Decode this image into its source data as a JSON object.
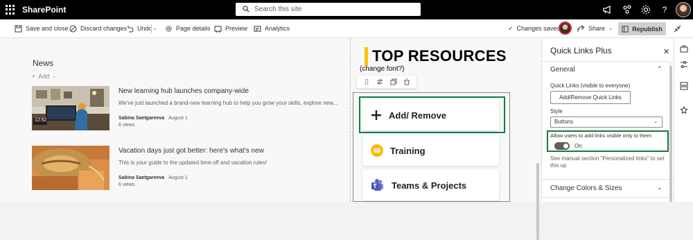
{
  "app": {
    "name": "SharePoint"
  },
  "search": {
    "placeholder": "Search this site"
  },
  "topbar": {
    "icons": [
      "megaphone-icon",
      "share-network-icon",
      "settings-gear-icon",
      "help-icon",
      "profile-avatar"
    ]
  },
  "commandbar": {
    "save_and_close": "Save and close",
    "discard_changes": "Discard changes",
    "undo": "Undo",
    "page_details": "Page details",
    "preview": "Preview",
    "analytics": "Analytics",
    "status": "Changes saved",
    "share": "Share",
    "republish": "Republish"
  },
  "news": {
    "title": "News",
    "add_label": "Add",
    "items": [
      {
        "headline": "New learning hub launches company-wide",
        "description": "We've just launched a brand-new learning hub to help you grow your skills, explore new...",
        "author": "Sabina Saetgareeva",
        "date": "August 1",
        "views": "6 views",
        "image_caption": "12:52"
      },
      {
        "headline": "Vacation days just got better: here's what's new",
        "description": "This is your guide to the updated time-off and vacation rules!",
        "author": "Sabina Saetgareeva",
        "date": "August 1",
        "views": "6 views"
      }
    ]
  },
  "resources": {
    "title": "TOP RESOURCES",
    "subtitle": "(change font?)",
    "toolbar_icons": [
      "drag-handle-icon",
      "edit-properties-icon",
      "duplicate-icon",
      "delete-icon"
    ],
    "links": [
      {
        "label": "Add/ Remove",
        "icon": "plus-icon"
      },
      {
        "label": "Training",
        "icon": "training-icon"
      },
      {
        "label": "Teams & Projects",
        "icon": "teams-icon"
      }
    ]
  },
  "panel": {
    "title": "Quick Links Plus",
    "section_general": "General",
    "quick_links_label": "Quick Links (visible to everyone)",
    "add_remove_button": "Add/Remove Quick Links",
    "style_label": "Style",
    "style_value": "Buttons",
    "allow_label": "Allow users to add links visible only to them",
    "toggle_state": "On",
    "note": "See manual section \"Personalized links\" to set this up",
    "section_colors": "Change Colors & Sizes"
  },
  "colors": {
    "accent_green": "#107c41",
    "yellow_bar": "#ffc000",
    "teams_purple": "#5b5fc7"
  }
}
